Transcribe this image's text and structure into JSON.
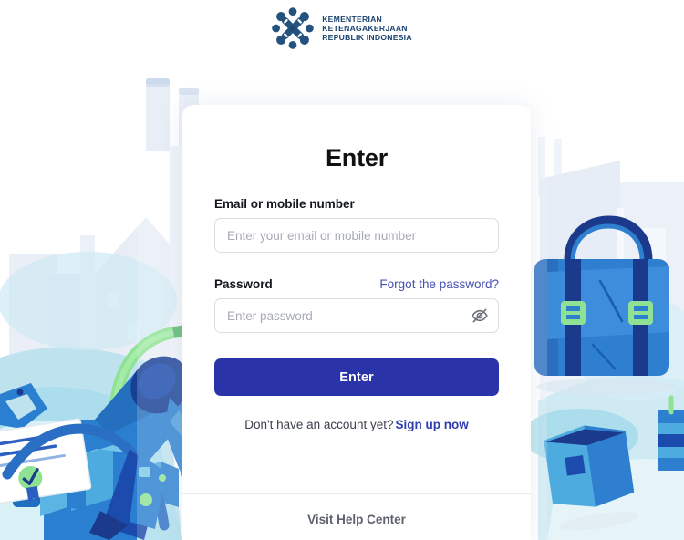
{
  "brand": {
    "logo_icon": "ministry-emblem-icon",
    "line1": "KEMENTERIAN",
    "line2": "KETENAGAKERJAAN",
    "line3": "REPUBLIK INDONESIA",
    "text_color": "#1b4370"
  },
  "card": {
    "title": "Enter"
  },
  "form": {
    "email": {
      "label": "Email or mobile number",
      "placeholder": "Enter your email or mobile number",
      "value": ""
    },
    "password": {
      "label": "Password",
      "placeholder": "Enter password",
      "value": "",
      "forgot_link": "Forgot the password?",
      "toggle_icon": "eye-off-icon"
    },
    "submit_label": "Enter"
  },
  "signup": {
    "prompt": "Don't have an account yet?",
    "link": "Sign up now"
  },
  "footer": {
    "help_link": "Visit Help Center"
  },
  "colors": {
    "primary_button": "#2a34a8",
    "link": "#4551b3",
    "signup_link": "#2f3db0",
    "help_text": "#5d6170",
    "placeholder": "#a8abb6",
    "illustration_blue": "#2f7fd0",
    "illustration_dark_blue": "#1b3a8c",
    "illustration_light_blue": "#7fcbe8",
    "illustration_green": "#7ae18a",
    "background": "#ffffff"
  }
}
